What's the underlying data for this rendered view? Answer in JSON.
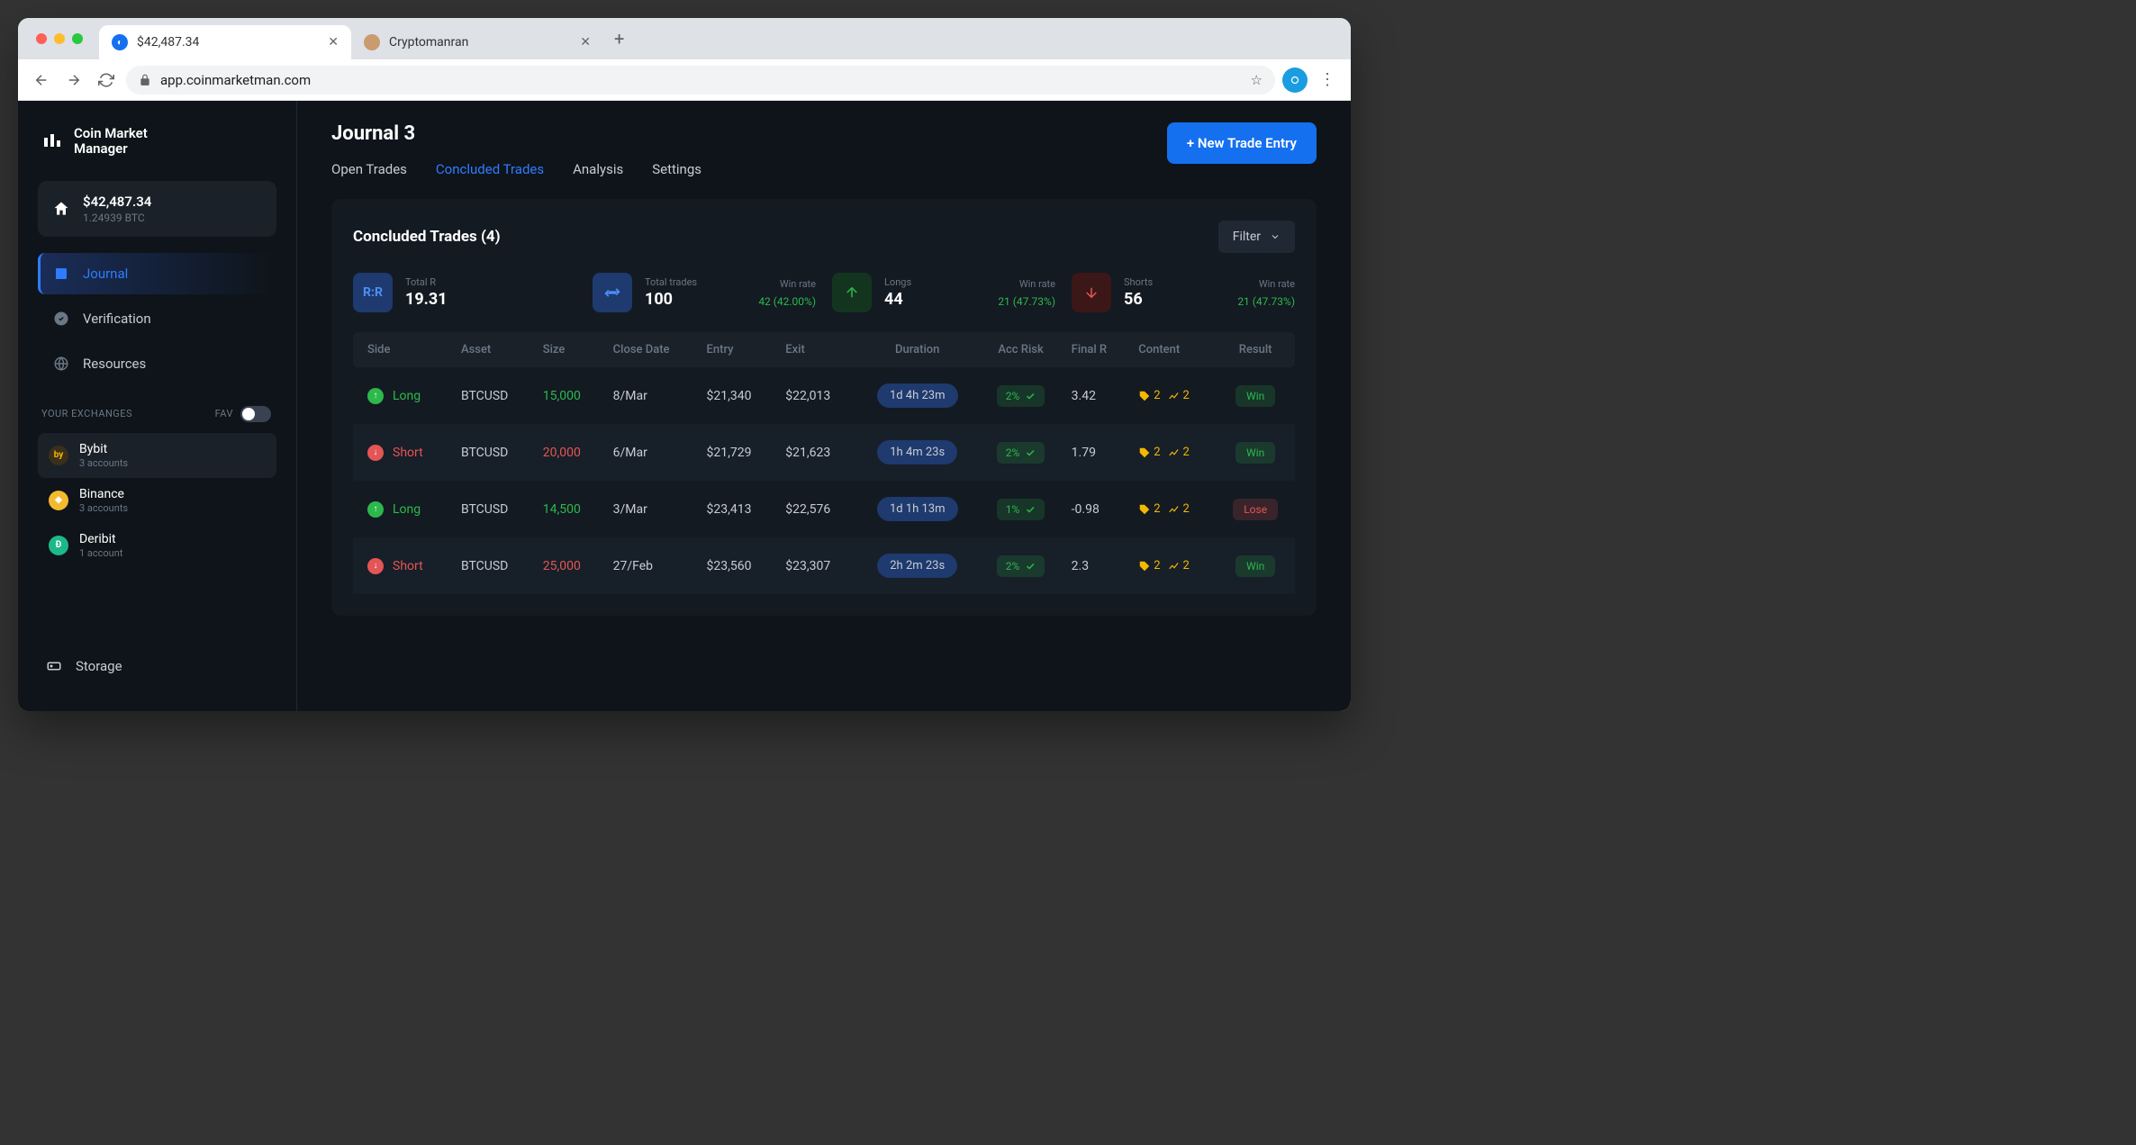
{
  "browser": {
    "tabs": [
      {
        "title": "$42,487.34",
        "favicon_color": "#1570ef"
      },
      {
        "title": "Cryptomanran",
        "favicon_color": "#c99b6e"
      }
    ],
    "url": "app.coinmarketman.com"
  },
  "sidebar": {
    "brand_line1": "Coin Market",
    "brand_line2": "Manager",
    "balance_usd": "$42,487.34",
    "balance_btc": "1.24939 BTC",
    "nav": [
      {
        "label": "Journal",
        "active": true
      },
      {
        "label": "Verification",
        "active": false
      },
      {
        "label": "Resources",
        "active": false
      }
    ],
    "exchanges_label": "YOUR EXCHANGES",
    "fav_label": "FAV",
    "exchanges": [
      {
        "name": "Bybit",
        "sub": "3 accounts",
        "color": "#3a2f1a",
        "selected": true
      },
      {
        "name": "Binance",
        "sub": "3 accounts",
        "color": "#f3ba2f",
        "selected": false
      },
      {
        "name": "Deribit",
        "sub": "1 account",
        "color": "#1db88a",
        "selected": false
      }
    ],
    "storage_label": "Storage"
  },
  "header": {
    "title": "Journal 3",
    "tabs": [
      {
        "label": "Open Trades",
        "active": false
      },
      {
        "label": "Concluded Trades",
        "active": true
      },
      {
        "label": "Analysis",
        "active": false
      },
      {
        "label": "Settings",
        "active": false
      }
    ],
    "new_trade_button": "+ New Trade Entry"
  },
  "panel": {
    "title": "Concluded Trades (4)",
    "filter_label": "Filter",
    "stats": {
      "total_r": {
        "label": "Total R",
        "value": "19.31"
      },
      "total_trades": {
        "label": "Total trades",
        "value": "100",
        "winrate_label": "Win rate",
        "winrate": "42 (42.00%)"
      },
      "longs": {
        "label": "Longs",
        "value": "44",
        "winrate_label": "Win rate",
        "winrate": "21 (47.73%)"
      },
      "shorts": {
        "label": "Shorts",
        "value": "56",
        "winrate_label": "Win rate",
        "winrate": "21 (47.73%)"
      }
    },
    "columns": [
      "Side",
      "Asset",
      "Size",
      "Close Date",
      "Entry",
      "Exit",
      "Duration",
      "Acc Risk",
      "Final R",
      "Content",
      "Result"
    ],
    "rows": [
      {
        "side": "Long",
        "asset": "BTCUSD",
        "size": "15,000",
        "close": "8/Mar",
        "entry": "$21,340",
        "exit": "$22,013",
        "duration": "1d 4h 23m",
        "risk": "2%",
        "finalr": "3.42",
        "tag_count": "2",
        "chart_count": "2",
        "result": "Win"
      },
      {
        "side": "Short",
        "asset": "BTCUSD",
        "size": "20,000",
        "close": "6/Mar",
        "entry": "$21,729",
        "exit": "$21,623",
        "duration": "1h 4m 23s",
        "risk": "2%",
        "finalr": "1.79",
        "tag_count": "2",
        "chart_count": "2",
        "result": "Win"
      },
      {
        "side": "Long",
        "asset": "BTCUSD",
        "size": "14,500",
        "close": "3/Mar",
        "entry": "$23,413",
        "exit": "$22,576",
        "duration": "1d 1h 13m",
        "risk": "1%",
        "finalr": "-0.98",
        "tag_count": "2",
        "chart_count": "2",
        "result": "Lose"
      },
      {
        "side": "Short",
        "asset": "BTCUSD",
        "size": "25,000",
        "close": "27/Feb",
        "entry": "$23,560",
        "exit": "$23,307",
        "duration": "2h 2m 23s",
        "risk": "2%",
        "finalr": "2.3",
        "tag_count": "2",
        "chart_count": "2",
        "result": "Win"
      }
    ]
  }
}
